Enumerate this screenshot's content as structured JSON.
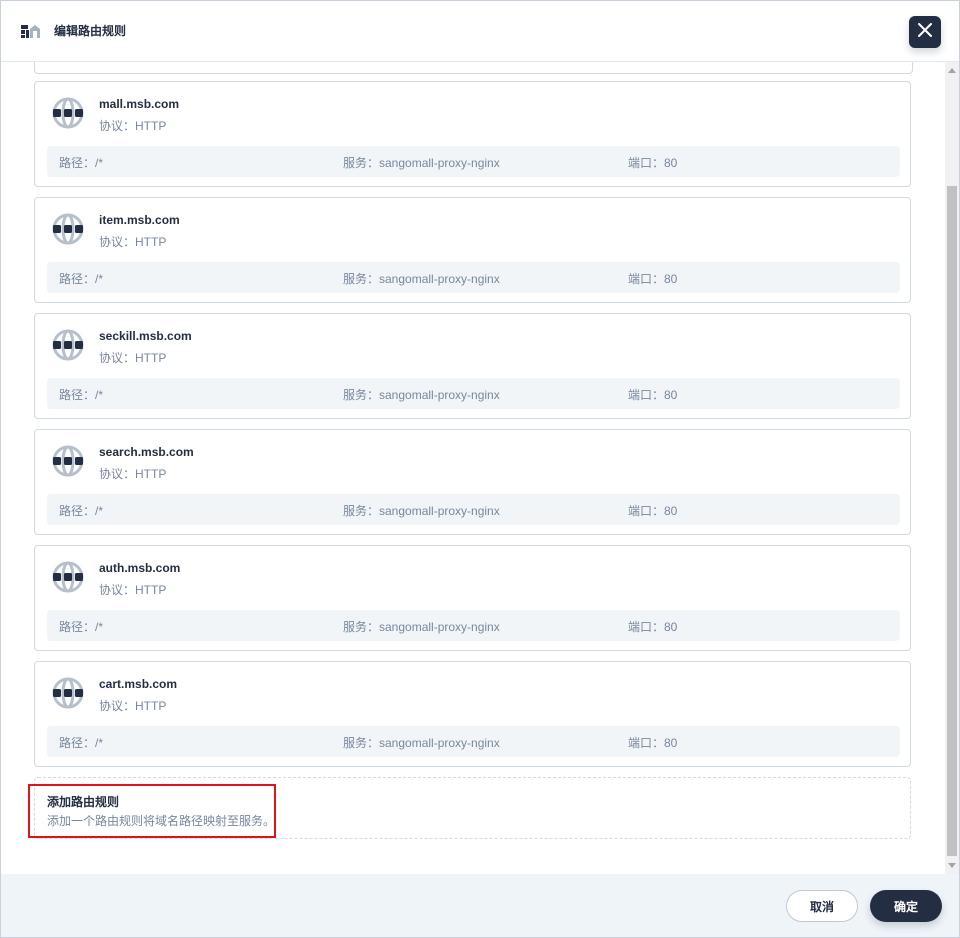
{
  "dialog": {
    "title": "编辑路由规则",
    "header_icon": "gateway-icon",
    "close_icon": "close-icon"
  },
  "rules": [
    {
      "host": "mall.msb.com",
      "protocol": "协议：HTTP",
      "path": "路径：/*",
      "service": "服务：sangomall-proxy-nginx",
      "port": "端口：80"
    },
    {
      "host": "item.msb.com",
      "protocol": "协议：HTTP",
      "path": "路径：/*",
      "service": "服务：sangomall-proxy-nginx",
      "port": "端口：80"
    },
    {
      "host": "seckill.msb.com",
      "protocol": "协议：HTTP",
      "path": "路径：/*",
      "service": "服务：sangomall-proxy-nginx",
      "port": "端口：80"
    },
    {
      "host": "search.msb.com",
      "protocol": "协议：HTTP",
      "path": "路径：/*",
      "service": "服务：sangomall-proxy-nginx",
      "port": "端口：80"
    },
    {
      "host": "auth.msb.com",
      "protocol": "协议：HTTP",
      "path": "路径：/*",
      "service": "服务：sangomall-proxy-nginx",
      "port": "端口：80"
    },
    {
      "host": "cart.msb.com",
      "protocol": "协议：HTTP",
      "path": "路径：/*",
      "service": "服务：sangomall-proxy-nginx",
      "port": "端口：80"
    }
  ],
  "rule_icon": "globe-icon",
  "add_rule": {
    "title": "添加路由规则",
    "description": "添加一个路由规则将域名路径映射至服务。"
  },
  "footer": {
    "cancel_label": "取消",
    "ok_label": "确定"
  },
  "colors": {
    "primary_dark": "#242e42",
    "muted_text": "#79879c",
    "highlight": "#e0131c"
  }
}
